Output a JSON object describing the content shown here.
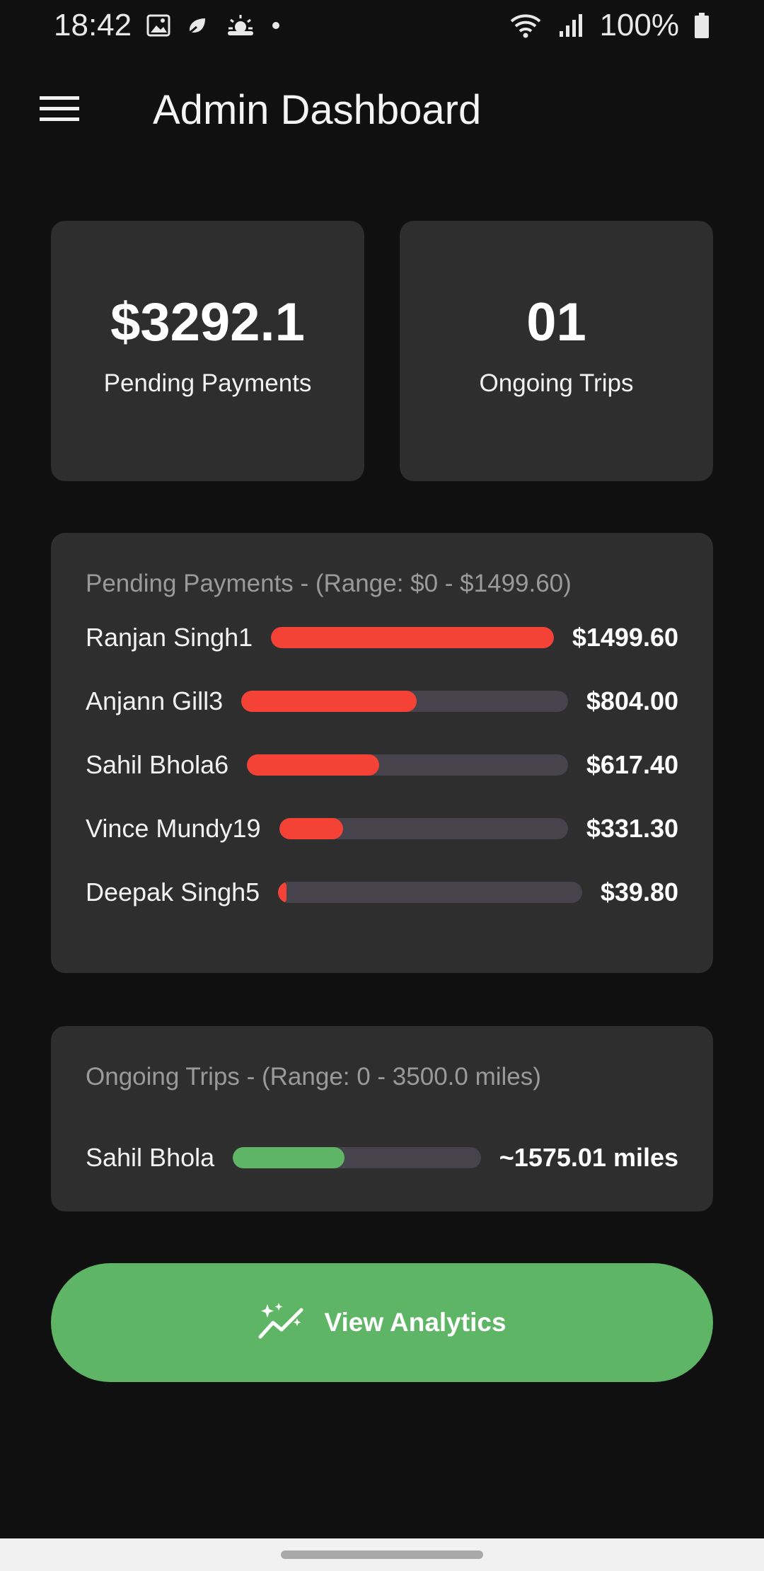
{
  "status_bar": {
    "time": "18:42",
    "battery_percent": "100%",
    "icons": [
      "gallery-icon",
      "cloud-leaf-icon",
      "weather-sun-icon",
      "notification-dot-icon",
      "wifi-icon",
      "signal-icon",
      "battery-icon"
    ]
  },
  "app_bar": {
    "title": "Admin Dashboard",
    "menu_icon": "hamburger-menu-icon"
  },
  "stats": {
    "pending_payments": {
      "value": "$3292.1",
      "label": "Pending Payments"
    },
    "ongoing_trips": {
      "value": "01",
      "label": "Ongoing Trips"
    }
  },
  "payments_panel": {
    "title": "Pending Payments - (Range: $0 - $1499.60)",
    "bar_color": "#f44336",
    "track_color": "#46434c",
    "rows": [
      {
        "name": "Ranjan Singh1",
        "value": "$1499.60",
        "fraction": 1.0
      },
      {
        "name": "Anjann Gill3",
        "value": "$804.00",
        "fraction": 0.536
      },
      {
        "name": "Sahil Bhola6",
        "value": "$617.40",
        "fraction": 0.412
      },
      {
        "name": "Vince Mundy19",
        "value": "$331.30",
        "fraction": 0.221
      },
      {
        "name": "Deepak Singh5",
        "value": "$39.80",
        "fraction": 0.027
      }
    ]
  },
  "trips_panel": {
    "title": "Ongoing Trips - (Range: 0 - 3500.0 miles)",
    "bar_color": "#5eb565",
    "rows": [
      {
        "name": "Sahil Bhola",
        "value": "~1575.01 miles",
        "fraction": 0.45
      }
    ]
  },
  "analytics_button": {
    "label": "View Analytics",
    "icon": "sparkle-trend-icon",
    "color": "#5eb565"
  }
}
